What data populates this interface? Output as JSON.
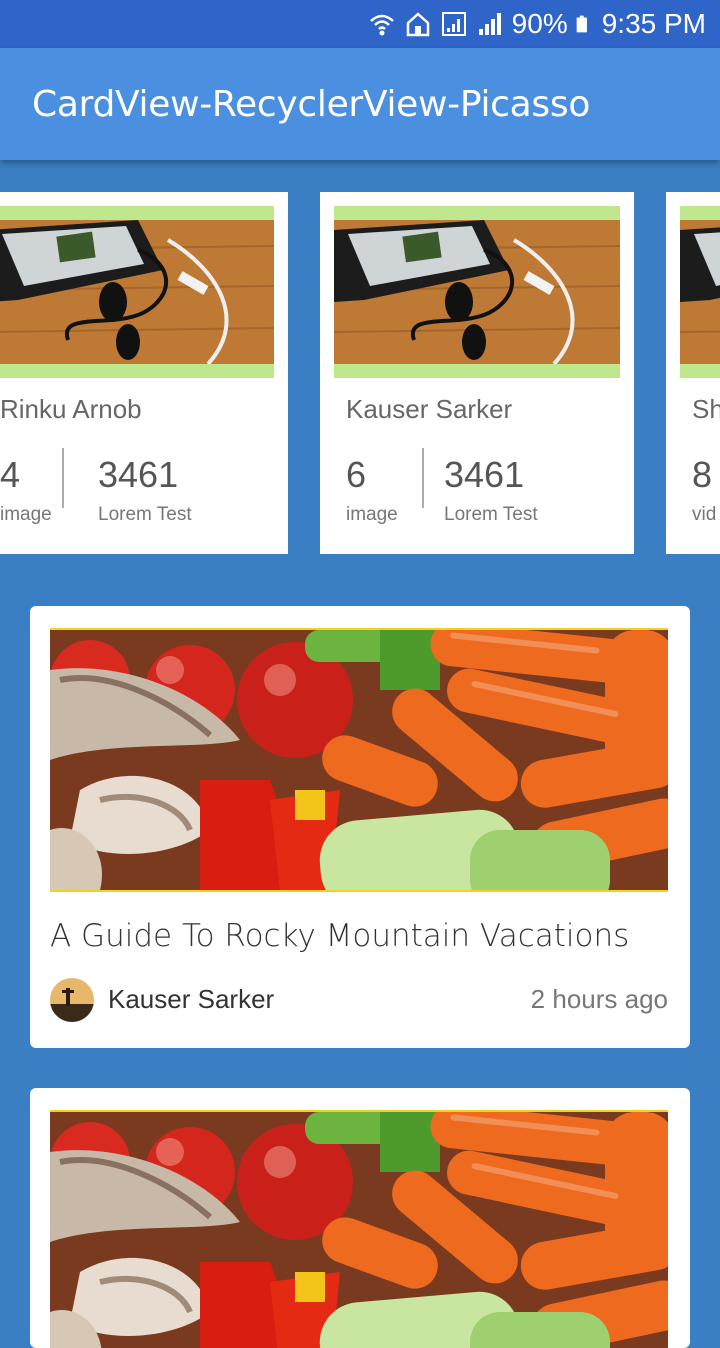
{
  "status_bar": {
    "battery": "90%",
    "time": "9:35 PM",
    "icons": [
      "wifi-icon",
      "home-icon",
      "sim-signal-icon",
      "signal-icon",
      "battery-icon"
    ]
  },
  "app_bar": {
    "title": "CardView-RecyclerView-Picasso"
  },
  "profile_cards": [
    {
      "name": "Rinku Arnob",
      "count": "4",
      "count_label": "image",
      "stat": "3461",
      "stat_label": "Lorem Test"
    },
    {
      "name": "Kauser Sarker",
      "count": "6",
      "count_label": "image",
      "stat": "3461",
      "stat_label": "Lorem Test"
    },
    {
      "name": "Sh",
      "count": "8",
      "count_label": "vid"
    }
  ],
  "posts": [
    {
      "title": "A Guide To Rocky Mountain Vacations",
      "author": "Kauser Sarker",
      "time": "2 hours ago"
    },
    {
      "title": ""
    }
  ],
  "colors": {
    "background": "#3a7fc4",
    "app_bar": "#4a8fe0",
    "status_bar": "#2f64c8",
    "thumb_frame": "#bfe88e",
    "image_border": "#f2d21e"
  }
}
